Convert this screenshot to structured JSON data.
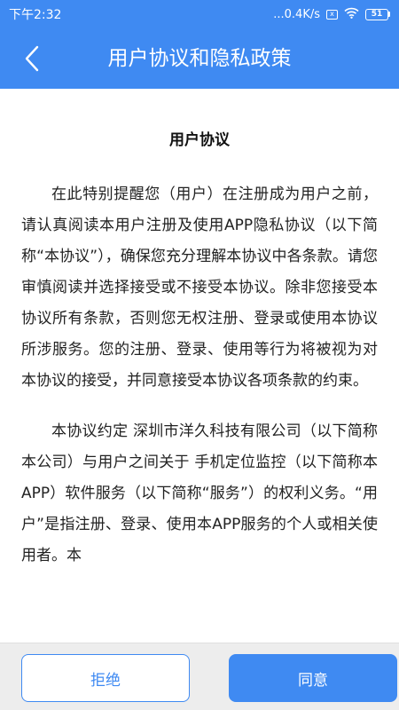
{
  "status_bar": {
    "time": "下午2:32",
    "network_speed": "...0.4K/s",
    "sim_icon": "x",
    "wifi_icon": "wifi-icon",
    "battery_level": "51"
  },
  "header": {
    "back_icon": "chevron-left-icon",
    "title": "用户协议和隐私政策"
  },
  "document": {
    "title": "用户协议",
    "paragraphs": [
      "在此特别提醒您（用户）在注册成为用户之前，请认真阅读本用户注册及使用APP隐私协议（以下简称“本协议”），确保您充分理解本协议中各条款。请您审慎阅读并选择接受或不接受本协议。除非您接受本协议所有条款，否则您无权注册、登录或使用本协议所涉服务。您的注册、登录、使用等行为将被视为对本协议的接受，并同意接受本协议各项条款的约束。",
      "本协议约定 深圳市洋久科技有限公司（以下简称本公司）与用户之间关于 手机定位监控（以下简称本APP）软件服务（以下简称“服务”）的权利义务。“用户”是指注册、登录、使用本APP服务的个人或相关使用者。本"
    ]
  },
  "footer": {
    "reject_label": "拒绝",
    "agree_label": "同意"
  },
  "colors": {
    "primary": "#3f8af2",
    "footer_bg": "#ededed"
  }
}
